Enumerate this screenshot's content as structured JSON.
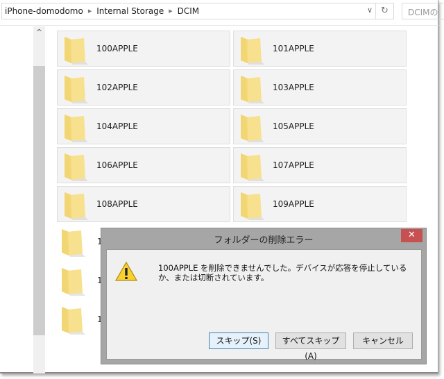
{
  "address_bar": {
    "crumbs": [
      "iPhone-domodomo",
      "Internal Storage",
      "DCIM"
    ],
    "search_placeholder": "DCIMの"
  },
  "folders": [
    "100APPLE",
    "101APPLE",
    "102APPLE",
    "103APPLE",
    "104APPLE",
    "105APPLE",
    "106APPLE",
    "107APPLE",
    "108APPLE",
    "109APPLE"
  ],
  "partial_folders": [
    "1",
    "1",
    "1"
  ],
  "dialog": {
    "title": "フォルダーの削除エラー",
    "message": "100APPLE を削除できませんでした。デバイスが応答を停止しているか、または切断されています。",
    "buttons": {
      "skip": "スキップ(S)",
      "skip_all": "すべてスキップ(A)",
      "cancel": "キャンセル"
    },
    "close": "✕",
    "icon": "warning-icon"
  },
  "colors": {
    "close_button": "#c75050",
    "folder": "#f5d97a",
    "accent": "#3c7fb1"
  }
}
